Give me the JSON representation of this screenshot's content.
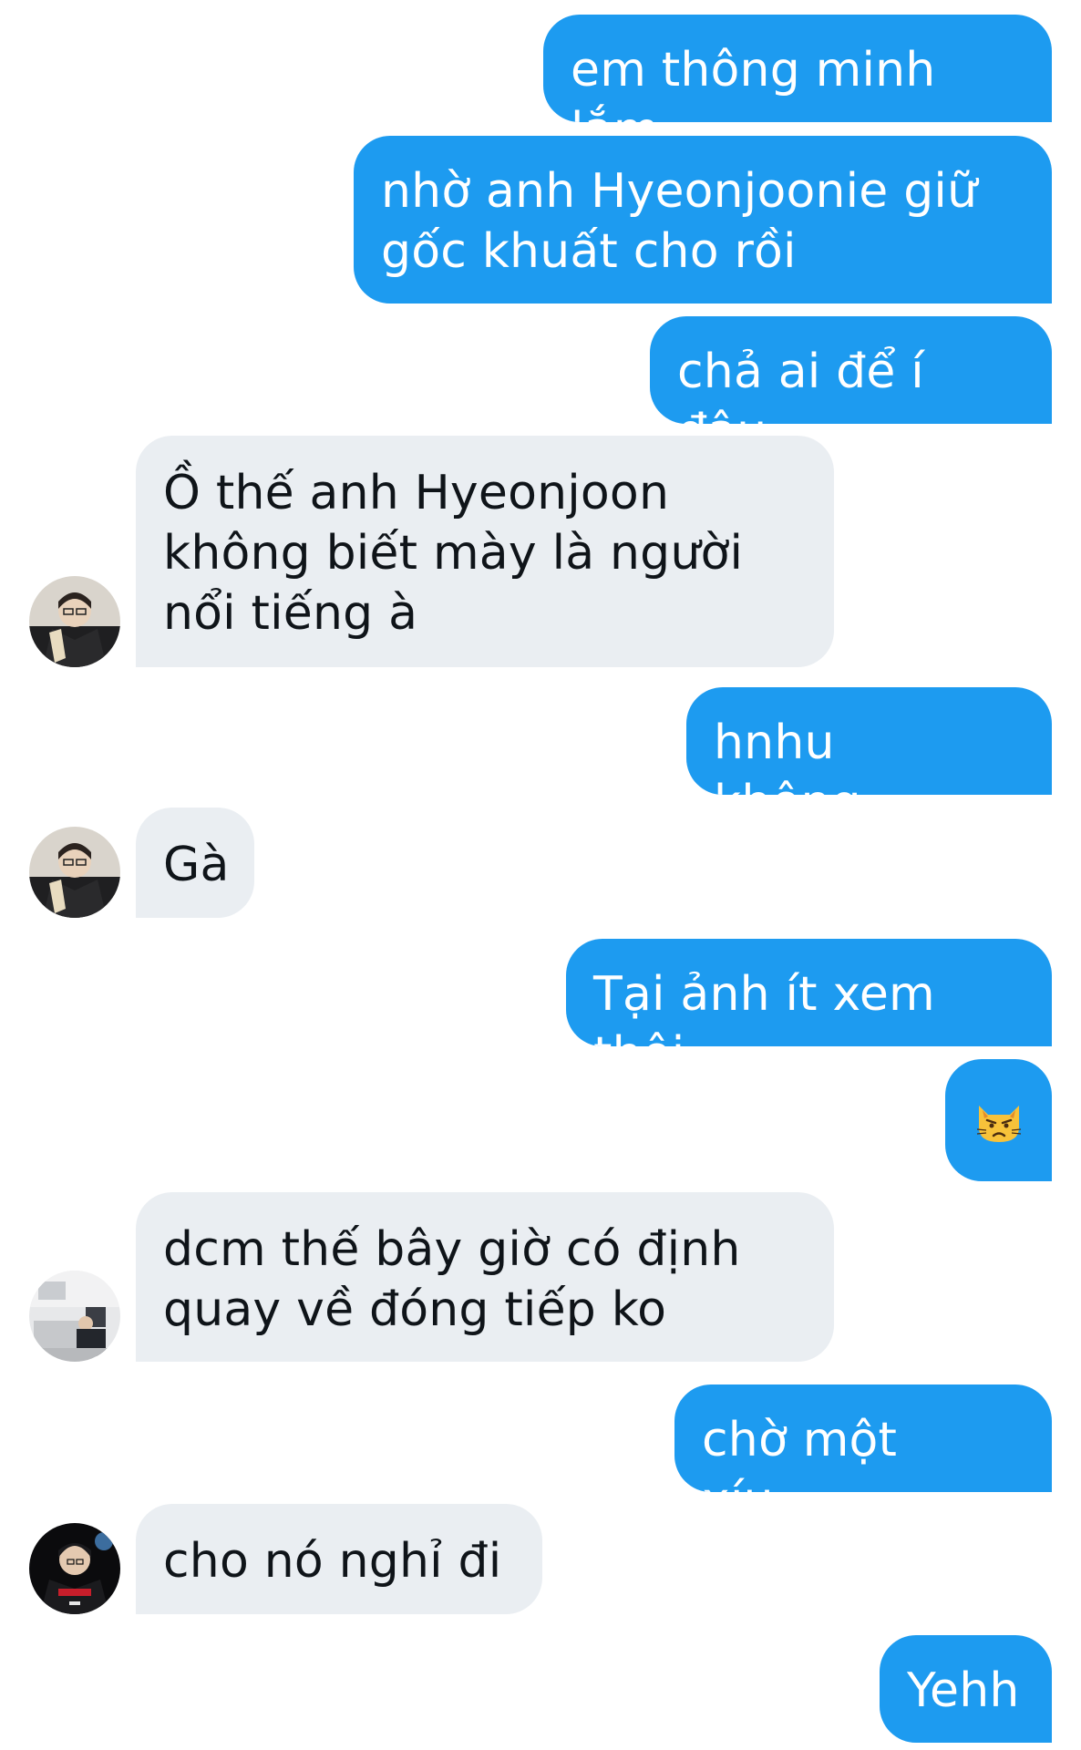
{
  "messages": [
    {
      "side": "out",
      "text": "em thông minh lắm"
    },
    {
      "side": "out",
      "text": "nhờ anh Hyeonjoonie giữ\ngốc khuất cho rồi"
    },
    {
      "side": "out",
      "text": "chả ai để í đâu"
    },
    {
      "side": "in",
      "text": "Ồ thế anh Hyeonjoon\nkhông biết mày là người\nnổi tiếng à",
      "avatar": "user-avatar-1"
    },
    {
      "side": "out",
      "text": "hnhu không.."
    },
    {
      "side": "in",
      "text": "Gà",
      "avatar": "user-avatar-1"
    },
    {
      "side": "out",
      "text": "Tại ảnh ít xem thôi"
    },
    {
      "side": "out",
      "emoji": "pouting-cat-emoji"
    },
    {
      "side": "in",
      "text": "dcm thế bây giờ có định\nquay về đóng tiếp ko",
      "avatar": "user-avatar-2"
    },
    {
      "side": "out",
      "text": "chờ một xíu..."
    },
    {
      "side": "in",
      "text": "cho nó nghỉ đi",
      "avatar": "user-avatar-3"
    },
    {
      "side": "out",
      "text": "Yehh"
    }
  ],
  "colors": {
    "outgoing_bubble": "#1d9bf0",
    "incoming_bubble": "#eaeef2",
    "outgoing_text": "#ffffff",
    "incoming_text": "#0f1419"
  }
}
